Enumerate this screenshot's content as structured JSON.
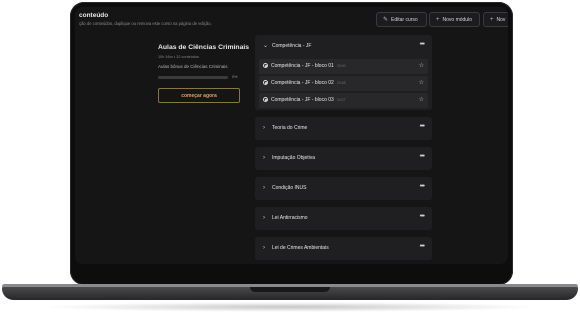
{
  "header": {
    "title": "conteúdo",
    "subtitle": "ção de conteúdos, duplique ou remova este curso na página de edição.",
    "buttons": [
      {
        "icon": "pencil-icon",
        "label": "Editar curso"
      },
      {
        "icon": "plus-icon",
        "label": "Novo módulo"
      },
      {
        "icon": "plus-icon",
        "label": "Nov"
      }
    ]
  },
  "course": {
    "title": "Aulas de Ciências Criminais",
    "meta": "10h 16m • 32 conteúdos",
    "description": "Aulas bônus de Ciências Criminais",
    "progress": 0,
    "progress_label": "0%",
    "start_label": "começar agora"
  },
  "modules": [
    {
      "title": "Competência - JF",
      "expanded": true,
      "lessons": [
        {
          "title": "Competência - JF - bloco 01",
          "duration": "33:00"
        },
        {
          "title": "Competência - JF - bloco 02",
          "duration": "23:58"
        },
        {
          "title": "Competência - JF - bloco 03",
          "duration": "24:07"
        }
      ]
    },
    {
      "title": "Teoria do Crime"
    },
    {
      "title": "Imputação Objetiva"
    },
    {
      "title": "Condição INUS"
    },
    {
      "title": "Lei Antirracismo"
    },
    {
      "title": "Lei de Crimes Ambientais"
    }
  ]
}
